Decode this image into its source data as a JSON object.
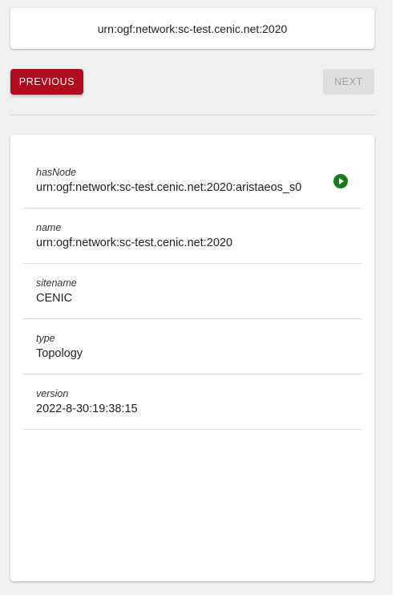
{
  "header": {
    "urn": "urn:ogf:network:sc-test.cenic.net:2020"
  },
  "navigation": {
    "previous_label": "PREVIOUS",
    "next_label": "NEXT",
    "next_disabled": true
  },
  "properties": [
    {
      "key": "hasNode",
      "value": "urn:ogf:network:sc-test.cenic.net:2020:aristaeos_s0",
      "has_action": true,
      "action_icon": "play-circle-icon"
    },
    {
      "key": "name",
      "value": "urn:ogf:network:sc-test.cenic.net:2020",
      "has_action": false
    },
    {
      "key": "sitename",
      "value": "CENIC",
      "has_action": false
    },
    {
      "key": "type",
      "value": "Topology",
      "has_action": false
    },
    {
      "key": "version",
      "value": "2022-8-30:19:38:15",
      "has_action": false
    }
  ],
  "colors": {
    "primary_button": "#b00b1c",
    "disabled_button": "#dedede",
    "action_icon": "#1b7a1b",
    "page_background": "#f0f0f0"
  }
}
